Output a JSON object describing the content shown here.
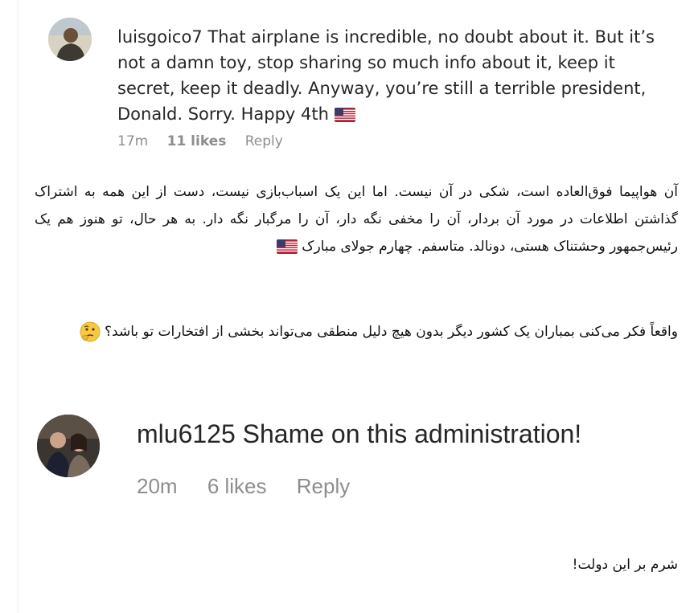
{
  "comment1": {
    "username": "luisgoico7",
    "text": "That airplane is incredible, no doubt about it. But it’s not a damn toy, stop sharing so much info about it, keep it secret, keep it deadly. Anyway, you’re still a terrible president, Donald. Sorry. Happy 4th",
    "flag_icon": "us-flag-emoji",
    "time": "17m",
    "likes": "11 likes",
    "reply": "Reply"
  },
  "translation1": {
    "text": "آن هواپیما فوق‌العاده است، شکی در آن نیست. اما این یک اسباب‌بازی نیست، دست از این همه به اشتراک گذاشتن اطلاعات در مورد آن بردار، آن را مخفی نگه دار، آن را مرگبار نگه دار. به هر حال، تو هنوز هم یک رئیس‌جمهور وحشتناک هستی، دونالد. متاسفم. چهارم جولای مبارک",
    "flag_icon": "us-flag-emoji"
  },
  "note": {
    "text": "واقعاً فکر می‌کنی بمباران یک کشور دیگر بدون هیچ دلیل منطقی می‌تواند بخشی از افتخارات تو باشد؟",
    "emoji_icon": "thinking-face-emoji"
  },
  "comment2": {
    "username": "mlu6125",
    "text": "Shame on this administration!",
    "time": "20m",
    "likes": "6 likes",
    "reply": "Reply"
  },
  "translation2": {
    "text": "شرم بر این دولت!"
  }
}
